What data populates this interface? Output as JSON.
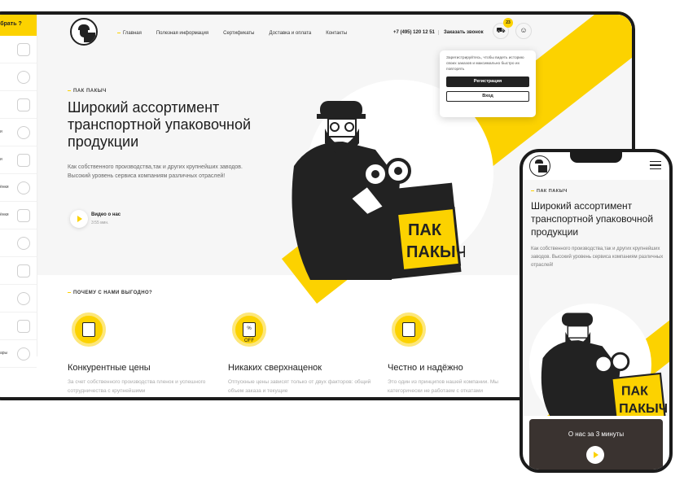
{
  "sidebar": {
    "header": "обрать ?",
    "items": [
      {
        "label": "",
        "icon": "tape-roll-icon"
      },
      {
        "label": "",
        "icon": "tape-icon"
      },
      {
        "label": "",
        "icon": "film-roll-icon"
      },
      {
        "label": "и",
        "icon": "double-roll-icon"
      },
      {
        "label": "и",
        "icon": "roll-icon"
      },
      {
        "label": "ёнки",
        "icon": "film-icon"
      },
      {
        "label": "ёнки",
        "icon": "stretch-film-icon"
      },
      {
        "label": "",
        "icon": "reel-icon"
      },
      {
        "label": "",
        "icon": "cutter-icon"
      },
      {
        "label": "",
        "icon": "box-icon"
      },
      {
        "label": "",
        "icon": "sticker-icon"
      },
      {
        "label": "ары",
        "icon": "tools-icon"
      }
    ]
  },
  "nav": {
    "links": [
      "Главная",
      "Полезная информация",
      "Сертификаты",
      "Доставка и оплата",
      "Контакты"
    ],
    "phone": "+7 (495) 120 12 51",
    "callback": "Заказать звонок",
    "cart_count": "23"
  },
  "popup": {
    "text": "Зарегистрируйтесь, чтобы видеть историю своих заказов и максимально быстро их повторять",
    "register": "Регистрация",
    "login": "Вход"
  },
  "hero": {
    "kicker": "ПАК ПАКЫЧ",
    "title": "Широкий ассортимент транспортной упаковочной продукции",
    "desc": "Как собственного производства,так и других крупнейших заводов. Высокий уровень сервиса компаниям различных отраслей!",
    "video_title": "Видео о нас",
    "video_duration": "3:55 мин."
  },
  "mascot": {
    "box_text_1": "ПАК",
    "box_text_2": "ПАКЫЧ"
  },
  "benefits": {
    "heading": "ПОЧЕМУ С НАМИ ВЫГОДНО?",
    "items": [
      {
        "icon_text": "",
        "title": "Конкурентные цены",
        "desc": "За счет собственного  производства пленок и  успешного сотрудничества с  крупнейшими"
      },
      {
        "icon_text": "% OFF",
        "title": "Никаких  сверхнаценок",
        "desc": "Отпускные цены зависят только от  двух факторов:  общий объем  заказа и текущие"
      },
      {
        "icon_text": "",
        "title": "Честно и надёжно",
        "desc": "Это один из принципов  нашей компании. Мы категорически не работаем с  откатами"
      }
    ]
  },
  "mobile": {
    "kicker": "ПАК ПАКЫЧ",
    "title": "Широкий ассортимент транспортной упаковочной продукции",
    "desc": "Как собственного производства,так и других крупнейших заводов. Высокий уровень сервиса компаниям различных отраслей!",
    "video_title": "О нас за 3 минуты"
  },
  "colors": {
    "accent": "#fcd200",
    "dark": "#1b1b1b",
    "bg": "#f6f6f6"
  }
}
